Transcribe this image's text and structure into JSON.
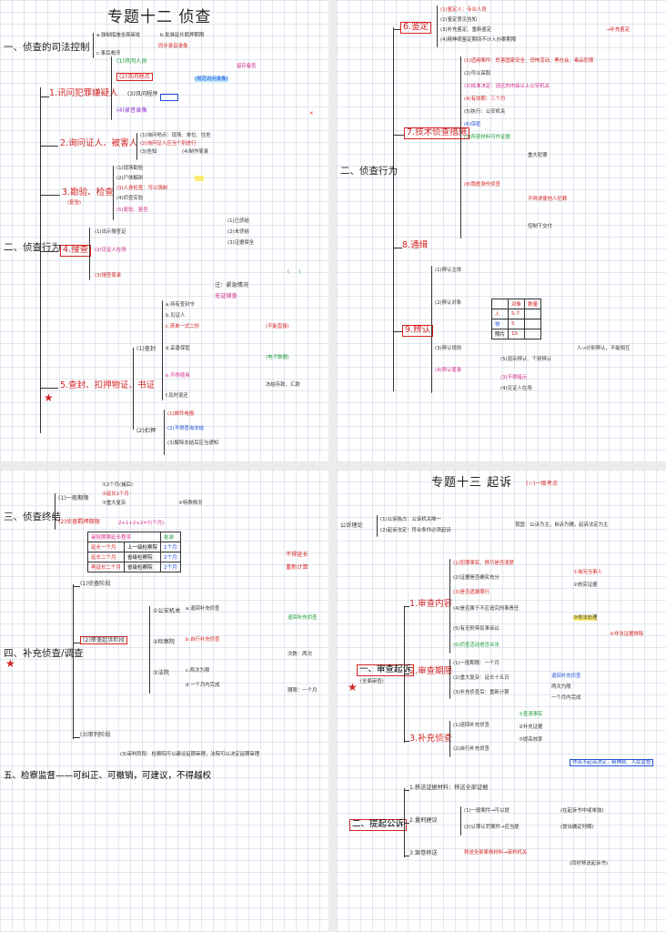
{
  "sheet1": {
    "title": "专题十二  侦查",
    "s1": "一、侦查的司法控制",
    "s1_items": [
      "a.强制措施全面审批",
      "b.批准延长羁押期限",
      "c.事后救济"
    ],
    "s2": "二、侦查行为",
    "b1": "1.讯问犯罪嫌疑人",
    "b1_items": [
      "(1)讯问人员",
      "(2)讯问地点",
      "(3)讯问程序",
      "(4)录音录像"
    ],
    "b1_notes": [
      "同步录音录像",
      "(规范讯问录像)",
      "留存备查"
    ],
    "b2": "2.询问证人、被害人",
    "b2_items": [
      "(1)询问地点：现场、单位、住处",
      "(2)询问证人应当个别进行",
      "(3)告知",
      "(4)制作笔录"
    ],
    "b3": "3.勘验、检查",
    "b3_sub": "(复验)",
    "b3_items": [
      "(1)现场勘验",
      "(2)尸体解剖",
      "(3)人身检查：可以强制",
      "(4)侦查实验",
      "(5)复验、复查"
    ],
    "b4": "4.搜查",
    "b4_items": [
      "(1)出示搜查证",
      "(2)见证人在场",
      "(3)搜查笔录"
    ],
    "b4_side": [
      "(1)已侦结",
      "(2)未侦结",
      "(3)证据保全"
    ],
    "b4_notes": [
      "注：紧急情况",
      "无证搜查"
    ],
    "b5": "5.查封、扣押物证、书证",
    "b5_a": "(1)查封",
    "b5_b": "(2)扣押",
    "b5_items": [
      "a.持有查封令",
      "b.见证人",
      "c.清单一式二份",
      "d.妥善保管",
      "e.不得使用",
      "f.及时退还"
    ],
    "b5_notes": [
      "(不能直接)",
      "(电子数据)",
      "冻结存款、汇款"
    ],
    "b5_tail": [
      "(1)邮件电报",
      "(2)不得查询冻结",
      "(3)解除冻结后应当通知"
    ]
  },
  "sheet2": {
    "b6": "6.鉴定",
    "b6_items": [
      "(1)鉴定人：专业人员",
      "(2)鉴定意见告知",
      "(3)补充鉴定、重新鉴定",
      "(4)精神病鉴定期间不计入办案期限"
    ],
    "b6_note": "→补充鉴定",
    "b7": "7.技术侦查措施",
    "b7_items": [
      "(1)适用案件：危害国家安全、恐怖活动、黑社会、毒品犯罪",
      "(2)可以采取",
      "(3)批准决定：设区的市级以上公安机关",
      "(4)有效期：三个月",
      "(5)执行：公安机关",
      "(6)保密",
      "(7)所获材料可作证据",
      "(8)隐匿身份侦查"
    ],
    "b7_notes": [
      "重大犯罪",
      "不得诱使他人犯罪",
      "控制下交付"
    ],
    "s2": "二、侦查行为",
    "b8": "8.通缉",
    "b9": "9.辨认",
    "b9_items": [
      "(1)辨认主体",
      "(2)辨认对象",
      "(3)辨认规则",
      "(4)辨认笔录"
    ],
    "b9_table": {
      "rows": [
        [
          "人",
          "5-7",
          ""
        ],
        [
          "物",
          "5",
          ""
        ],
        [
          "照片",
          "10",
          ""
        ]
      ],
      "header": [
        "",
        "对象",
        "数量"
      ]
    },
    "b9_rule": "(5)混杂辨认、个别辨认",
    "b9_tail": "人→分别辨认，不能相互",
    "b9_bottom": [
      "(3)不得暗示",
      "(4)见证人在场"
    ]
  },
  "sheet3": {
    "s3": "三、侦查终结",
    "s3_items": [
      "(1)一般期限",
      "(2)侦查羁押期限"
    ],
    "s3_notes": [
      "①2个月(捕后)",
      "②延长1个月",
      "③重大复杂",
      "④特殊情况"
    ],
    "s3_deadline": "2+1+2+2=7(个月)",
    "table_header": [
      "审批期限延长程序",
      "批准"
    ],
    "table_rows": [
      [
        "延长一个月",
        "上一级检察院",
        "1个月"
      ],
      [
        "延长二个月",
        "省级检察院",
        "2个月"
      ],
      [
        "再延长二个月",
        "省级检察院",
        "2个月"
      ]
    ],
    "table_tail": [
      "不得延长",
      "重新计算"
    ],
    "s4": "四、补充侦查/调查",
    "s4_items": [
      "(1)审查起诉阶段",
      "(2)审判阶段"
    ],
    "s4_a": "(1)侦查阶段",
    "s4_b": "(2)审查起诉阶段",
    "s4_c": "(3)审判阶段",
    "s4_sub": [
      "①公安机关",
      "②检察院",
      "③法院"
    ],
    "s4_sub_items": [
      "a.退回补充侦查",
      "b.自行补充侦查",
      "c.两次为限",
      "d.一个月内完成"
    ],
    "s4_notes": [
      "退回补充侦查",
      "次数：两次",
      "期限：一个月"
    ],
    "s4_bottom": "(3)审判阶段：检察院可以建议延期审理，法院可以决定延期审理",
    "s5": "五、检察监督——可纠正、可撤销，可建议，不得越权"
  },
  "sheet4": {
    "title": "专题十三  起诉",
    "title_note": "(☆)一级考点",
    "intro": "公诉理论",
    "intro_items": [
      "(1)公诉独占：公诉机关唯一",
      "(2)起诉法定：符合条件必须起诉"
    ],
    "intro_side": "我国：公诉为主，自诉为辅，起诉法定为主",
    "s1": "一、审查起诉",
    "s1_sub": "(全面审查)",
    "b1": "1.审查内容",
    "b1_items": [
      "(1)犯罪事实、情节是否清楚",
      "(2)证据是否确实充分",
      "(3)是否遗漏罪行",
      "(4)是否属于不应追究刑事责任",
      "(5)有无附带民事诉讼",
      "(6)侦查活动是否合法"
    ],
    "b1_notes": [
      "①询问当事人",
      "②核实证据",
      "③依法处理",
      "④非法证据排除"
    ],
    "b2": "2.审查期限",
    "b2_items": [
      "(1)一般期限：一个月",
      "(2)重大复杂：延长十五日",
      "(3)补充侦查后：重新计算"
    ],
    "b2_notes": [
      "退回补充侦查",
      "两次为限",
      "一个月内完成"
    ],
    "b3": "3.补充侦查",
    "b3_items": [
      "(1)退回补充侦查",
      "(2)自行补充侦查"
    ],
    "b3_notes": [
      "①查清事实",
      "②补充证据",
      "③提高效率"
    ],
    "b3_tail": "作出不起诉决定，精神病、人民监督",
    "s2": "二、提起公诉",
    "s2_items": [
      "1.移送证据材料：移送全部证据",
      "2.量刑建议",
      "3.案卷移送"
    ],
    "s2_sub": [
      "(1)一般案件→可以提",
      "(2)认罪认罚案件→应当提"
    ],
    "s2_sub_notes": [
      "(在起诉书中或单独)",
      "(提出确定刑期)"
    ],
    "s2_last": "移送全部案卷材料→审判机关",
    "s2_last_note": "(同时移送起诉书)"
  }
}
